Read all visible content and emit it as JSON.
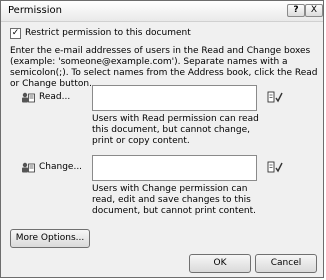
{
  "window": {
    "title": "Permission"
  },
  "titlebar": {
    "help_glyph": "?",
    "close_glyph": "X"
  },
  "restrict": {
    "label": "Restrict permission to this document",
    "checked": true,
    "check_glyph": "✓"
  },
  "instructions": "Enter the e-mail addresses of users in the Read and Change boxes (example: 'someone@example.com'). Separate names with a semicolon(;). To select names from the Address book, click the Read or Change button.",
  "read": {
    "label": "Read...",
    "help": "Users with Read permission can read this document, but cannot change, print or copy content."
  },
  "change": {
    "label": "Change...",
    "help": "Users with Change permission can read, edit and save changes to this document, but cannot print content."
  },
  "buttons": {
    "more_options": "More Options...",
    "ok": "OK",
    "cancel": "Cancel"
  }
}
